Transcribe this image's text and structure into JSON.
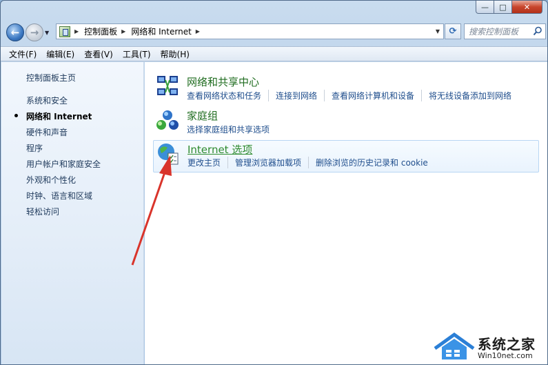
{
  "window": {
    "caption": {
      "minimize": "—",
      "maximize": "□",
      "close": "✕"
    }
  },
  "nav": {
    "breadcrumbs": [
      "控制面板",
      "网络和 Internet"
    ],
    "search_placeholder": "搜索控制面板"
  },
  "menu": [
    "文件(F)",
    "编辑(E)",
    "查看(V)",
    "工具(T)",
    "帮助(H)"
  ],
  "sidebar": {
    "home": "控制面板主页",
    "items": [
      {
        "label": "系统和安全",
        "active": false
      },
      {
        "label": "网络和 Internet",
        "active": true
      },
      {
        "label": "硬件和声音",
        "active": false
      },
      {
        "label": "程序",
        "active": false
      },
      {
        "label": "用户帐户和家庭安全",
        "active": false
      },
      {
        "label": "外观和个性化",
        "active": false
      },
      {
        "label": "时钟、语言和区域",
        "active": false
      },
      {
        "label": "轻松访问",
        "active": false
      }
    ]
  },
  "categories": [
    {
      "title": "网络和共享中心",
      "icon": "network-sharing-center-icon",
      "links": [
        "查看网络状态和任务",
        "连接到网络",
        "查看网络计算机和设备",
        "将无线设备添加到网络"
      ]
    },
    {
      "title": "家庭组",
      "icon": "homegroup-icon",
      "links": [
        "选择家庭组和共享选项"
      ]
    },
    {
      "title": "Internet 选项",
      "icon": "internet-options-icon",
      "links": [
        "更改主页",
        "管理浏览器加载项",
        "删除浏览的历史记录和 cookie"
      ],
      "highlighted": true
    }
  ],
  "watermark": {
    "main": "系统之家",
    "sub": "Win10net.com"
  },
  "colors": {
    "link": "#1e4d8c",
    "category_title": "#1f6c1f",
    "annotation_arrow": "#d9342b"
  }
}
